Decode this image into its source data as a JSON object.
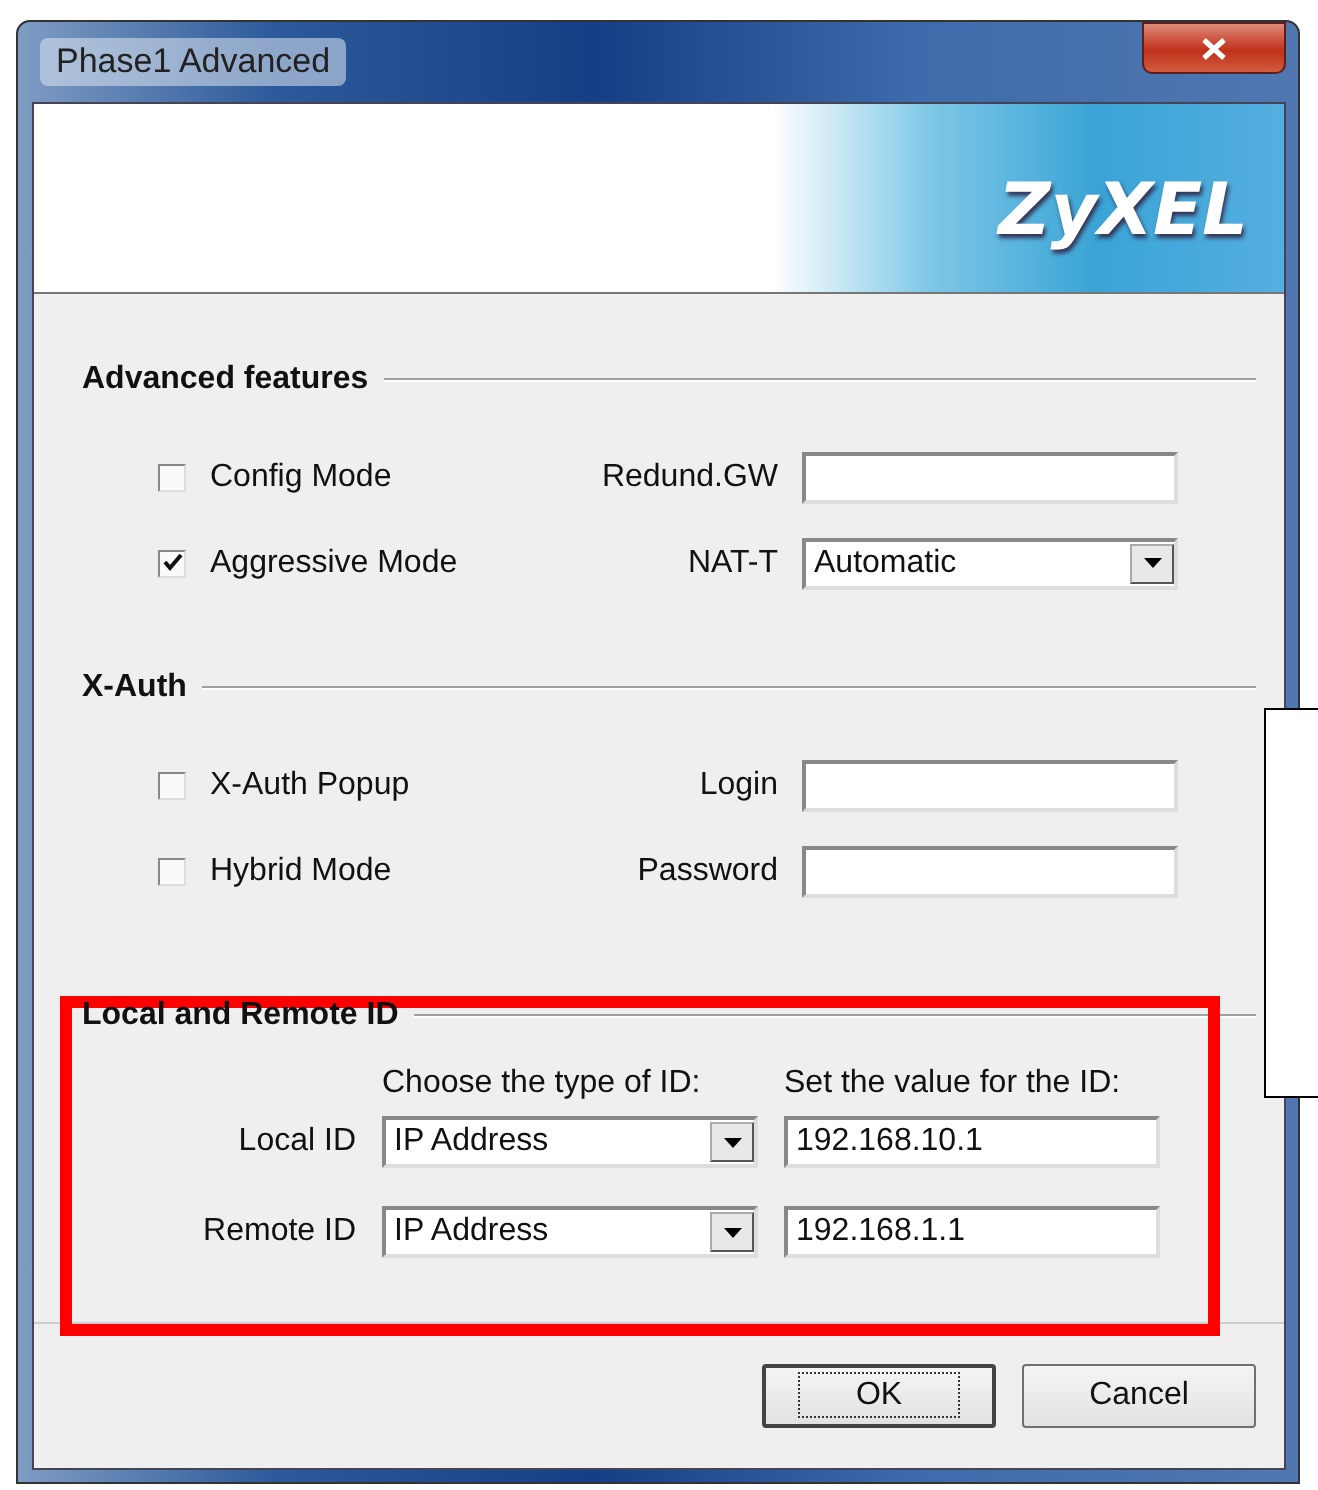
{
  "window": {
    "title": "Phase1 Advanced"
  },
  "banner": {
    "logo": "ZyXEL"
  },
  "sections": [
    {
      "title": "Advanced features",
      "rows": [
        {
          "checkbox": {
            "label": "Config Mode",
            "checked": false
          },
          "field": {
            "label": "Redund.GW",
            "kind": "text"
          }
        },
        {
          "checkbox": {
            "label": "Aggressive Mode",
            "checked": true
          },
          "field": {
            "label": "NAT-T",
            "kind": "select",
            "value": "Automatic"
          }
        }
      ]
    },
    {
      "title": "X-Auth",
      "rows": [
        {
          "checkbox": {
            "label": "X-Auth Popup",
            "checked": false
          },
          "field": {
            "label": "Login",
            "kind": "text"
          }
        },
        {
          "checkbox": {
            "label": "Hybrid Mode",
            "checked": false
          },
          "field": {
            "label": "Password",
            "kind": "text"
          }
        }
      ]
    }
  ],
  "id_section": {
    "title": "Local and Remote ID",
    "headers": [
      "Choose the type of ID:",
      "Set the value for the ID:"
    ],
    "rows": [
      {
        "label": "Local ID",
        "type": "IP Address",
        "value": "192.168.10.1"
      },
      {
        "label": "Remote ID",
        "type": "IP Address",
        "value": "192.168.1.1"
      }
    ]
  },
  "buttons": [
    {
      "label": "OK",
      "focused": true
    },
    {
      "label": "Cancel",
      "focused": false
    }
  ]
}
